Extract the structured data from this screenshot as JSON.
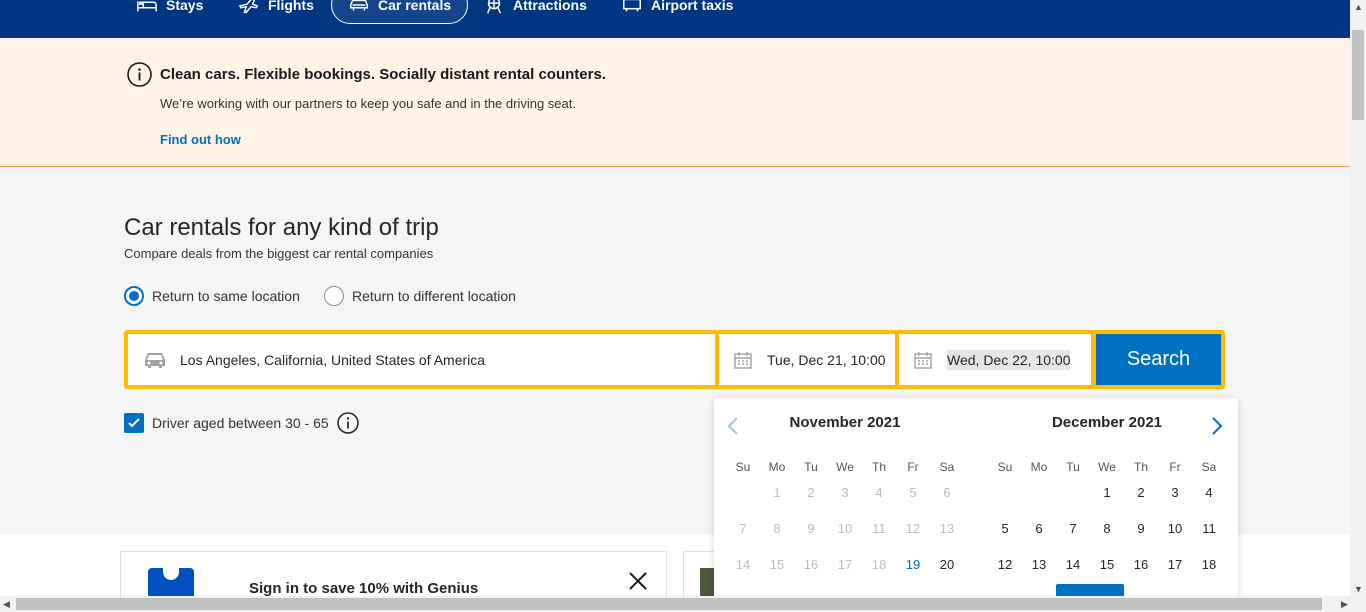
{
  "nav": {
    "stays": "Stays",
    "flights": "Flights",
    "car_rentals": "Car rentals",
    "attractions": "Attractions",
    "airport_taxis": "Airport taxis"
  },
  "banner": {
    "title": "Clean cars. Flexible bookings. Socially distant rental counters.",
    "subtitle": "We’re working with our partners to keep you safe and in the driving seat.",
    "link": "Find out how"
  },
  "main": {
    "title": "Car rentals for any kind of trip",
    "subtitle": "Compare deals from the biggest car rental companies"
  },
  "return_options": {
    "same": "Return to same location",
    "different": "Return to different location",
    "selected": "same"
  },
  "search": {
    "location": "Los Angeles, California, United States of America",
    "pickup": "Tue, Dec 21, 10:00",
    "dropoff": "Wed, Dec 22, 10:00",
    "button": "Search"
  },
  "driver": {
    "label": "Driver aged between 30 - 65",
    "checked": true
  },
  "calendar": {
    "weekdays": [
      "Su",
      "Mo",
      "Tu",
      "We",
      "Th",
      "Fr",
      "Sa"
    ],
    "months": [
      {
        "title": "November 2021",
        "rows": [
          [
            "",
            "1",
            "2",
            "3",
            "4",
            "5",
            "6"
          ],
          [
            "7",
            "8",
            "9",
            "10",
            "11",
            "12",
            "13"
          ],
          [
            "14",
            "15",
            "16",
            "17",
            "18",
            "19",
            "20"
          ]
        ],
        "past_until": 18,
        "today": 19
      },
      {
        "title": "December 2021",
        "rows": [
          [
            "",
            "",
            "",
            "1",
            "2",
            "3",
            "4"
          ],
          [
            "5",
            "6",
            "7",
            "8",
            "9",
            "10",
            "11"
          ],
          [
            "12",
            "13",
            "14",
            "15",
            "16",
            "17",
            "18"
          ]
        ]
      }
    ]
  },
  "promo": {
    "text": "Sign in to save 10% with Genius"
  },
  "colors": {
    "nav_bg": "#003580",
    "accent": "#0071c2",
    "search_border": "#febb02",
    "banner_bg": "#fef3e6"
  }
}
